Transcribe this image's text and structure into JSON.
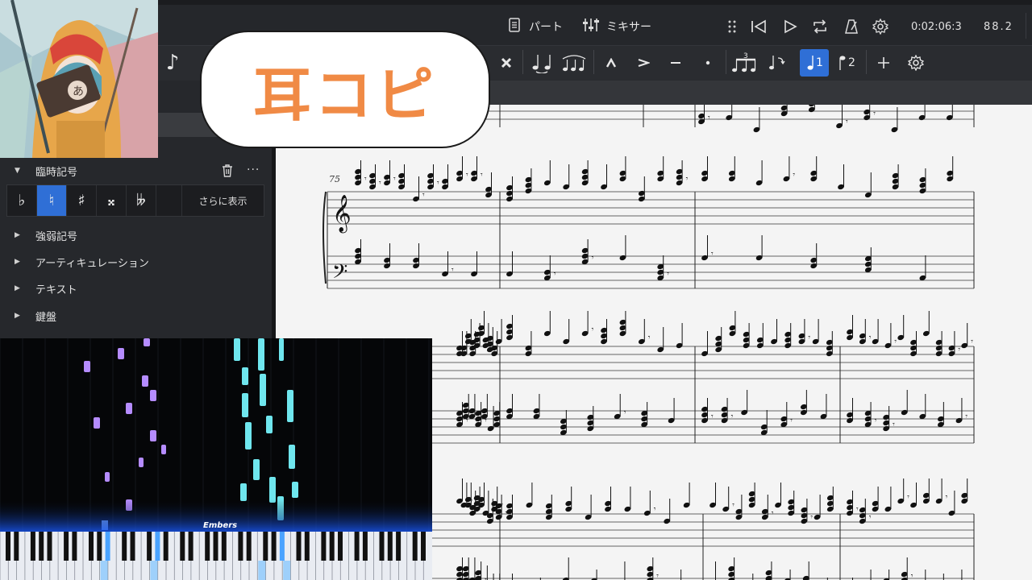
{
  "toolbar": {
    "part_label": "パート",
    "mixer_label": "ミキサー",
    "time": "0:02:06:3",
    "tempo": "88.2"
  },
  "overlay": {
    "caption": "耳コピ",
    "piano_title": "Embers"
  },
  "palette": {
    "voice1": "1",
    "voice2": "2",
    "tuplet_number": "3"
  },
  "panel": {
    "accidentals_header": "臨時記号",
    "accidentals_buttons": [
      "♭",
      "♮",
      "♯",
      "𝄪",
      "𝄫"
    ],
    "more_label": "さらに表示",
    "sections": [
      "強弱記号",
      "アーティキュレーション",
      "テキスト",
      "鍵盤"
    ]
  },
  "score": {
    "measure_number": "75"
  },
  "icons": [
    "note-icon",
    "document-icon",
    "mixer-icon",
    "grip-icon",
    "rewind-icon",
    "play-icon",
    "loop-icon",
    "metronome-icon",
    "gear-icon",
    "trash-icon",
    "more-icon",
    "plus-icon"
  ]
}
